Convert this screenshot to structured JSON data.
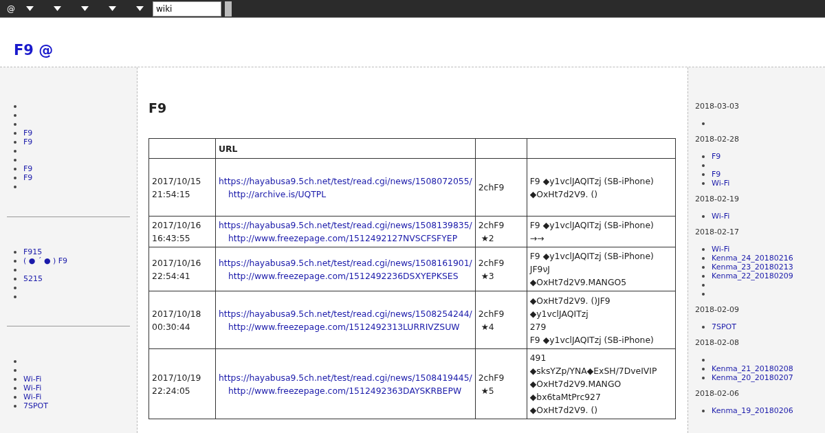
{
  "topbar": {
    "menus": [
      {
        "kind": "text",
        "label": "@"
      },
      {
        "kind": "caret"
      },
      {
        "kind": "caret"
      },
      {
        "kind": "caret"
      },
      {
        "kind": "caret"
      },
      {
        "kind": "caret"
      }
    ],
    "search": {
      "value": "wiki"
    }
  },
  "site_title": "F9 @",
  "left_sidebar": {
    "sections": [
      {
        "items": [
          {
            "kind": "blank"
          },
          {
            "kind": "blank"
          },
          {
            "kind": "blank"
          },
          {
            "kind": "link",
            "label": "F9"
          },
          {
            "kind": "link",
            "label": "F9"
          },
          {
            "kind": "blank"
          },
          {
            "kind": "blank"
          },
          {
            "kind": "link",
            "label": "F9"
          },
          {
            "kind": "link",
            "label": "F9"
          },
          {
            "kind": "blank"
          }
        ]
      },
      {
        "items": [
          {
            "kind": "link",
            "label": "F915"
          },
          {
            "kind": "link",
            "label": "( ● ´  ● ) F9"
          },
          {
            "kind": "blank"
          },
          {
            "kind": "link",
            "label": "5215"
          },
          {
            "kind": "blank"
          },
          {
            "kind": "blank"
          }
        ]
      },
      {
        "items": [
          {
            "kind": "blank"
          },
          {
            "kind": "blank"
          },
          {
            "kind": "link",
            "label": "Wi-Fi"
          },
          {
            "kind": "link",
            "label": "Wi-Fi"
          },
          {
            "kind": "link",
            "label": "Wi-Fi"
          },
          {
            "kind": "link",
            "label": "7SPOT"
          }
        ]
      }
    ]
  },
  "page_title": "F9",
  "table": {
    "columns": [
      {
        "kind": "blank"
      },
      {
        "kind": "text",
        "label": "URL"
      },
      {
        "kind": "blank"
      },
      {
        "kind": "blank"
      }
    ],
    "rows": [
      {
        "datetime": "2017/10/15 21:54:15",
        "url": "https://hayabusa9.5ch.net/test/read.cgi/news/1508072055/",
        "archive": "http://archive.is/UQTPL",
        "source": [
          "2chF9"
        ],
        "notes": [
          "F9 ◆y1vclJAQITzj (SB-iPhone)",
          " ◆OxHt7d2V9. ()"
        ]
      },
      {
        "datetime": "2017/10/16 16:43:55",
        "url": "https://hayabusa9.5ch.net/test/read.cgi/news/1508139835/",
        "archive": "http://www.freezepage.com/1512492127NVSCFSFYEP",
        "source": [
          "2chF9",
          "★2"
        ],
        "notes": [
          "F9 ◆y1vclJAQITzj (SB-iPhone)",
          "→→"
        ]
      },
      {
        "datetime": "2017/10/16 22:54:41",
        "url": "https://hayabusa9.5ch.net/test/read.cgi/news/1508161901/",
        "archive": "http://www.freezepage.com/1512492236DSXYEPKSES",
        "source": [
          "2chF9",
          "★3"
        ],
        "notes": [
          "F9 ◆y1vclJAQITzj (SB-iPhone)",
          "JF9νJ",
          " ◆OxHt7d2V9.MANGO5"
        ]
      },
      {
        "datetime": "2017/10/18 00:30:44",
        "url": "https://hayabusa9.5ch.net/test/read.cgi/news/1508254244/",
        "archive": "http://www.freezepage.com/1512492313LURRIVZSUW",
        "source": [
          "2chF9",
          "★4"
        ],
        "notes": [
          " ◆OxHt7d2V9. ()JF9",
          "◆y1vclJAQITzj",
          "279",
          "F9 ◆y1vclJAQITzj (SB-iPhone)"
        ]
      },
      {
        "datetime": "2017/10/19 22:24:05",
        "url": "https://hayabusa9.5ch.net/test/read.cgi/news/1508419445/",
        "archive": "http://www.freezepage.com/1512492363DAYSKRBEPW",
        "source": [
          "2chF9",
          "★5"
        ],
        "notes": [
          "491",
          " ◆sksYZp/YNA◆ExSH/7DveIVIP",
          " ◆OxHt7d2V9.MANGO",
          "◆bx6taMtPrc927",
          " ◆OxHt7d2V9. ()"
        ]
      }
    ]
  },
  "right_sidebar": {
    "groups": [
      {
        "date": "2018-03-03",
        "items": [
          {
            "kind": "blank"
          }
        ]
      },
      {
        "date": "2018-02-28",
        "items": [
          {
            "kind": "link",
            "label": "F9"
          },
          {
            "kind": "blank"
          },
          {
            "kind": "link",
            "label": "F9"
          },
          {
            "kind": "link",
            "label": "Wi-Fi"
          }
        ]
      },
      {
        "date": "2018-02-19",
        "items": [
          {
            "kind": "link",
            "label": "Wi-Fi"
          }
        ]
      },
      {
        "date": "2018-02-17",
        "items": [
          {
            "kind": "link",
            "label": "Wi-Fi"
          },
          {
            "kind": "link",
            "label": "Kenma_24_20180216"
          },
          {
            "kind": "link",
            "label": "Kenma_23_20180213"
          },
          {
            "kind": "link",
            "label": "Kenma_22_20180209"
          },
          {
            "kind": "blank"
          },
          {
            "kind": "blank"
          }
        ]
      },
      {
        "date": "2018-02-09",
        "items": [
          {
            "kind": "link",
            "label": "7SPOT"
          }
        ]
      },
      {
        "date": "2018-02-08",
        "items": [
          {
            "kind": "blank"
          },
          {
            "kind": "link",
            "label": "Kenma_21_20180208"
          },
          {
            "kind": "link",
            "label": "Kenma_20_20180207"
          }
        ]
      },
      {
        "date": "2018-02-06",
        "items": [
          {
            "kind": "link",
            "label": "Kenma_19_20180206"
          }
        ]
      }
    ]
  }
}
